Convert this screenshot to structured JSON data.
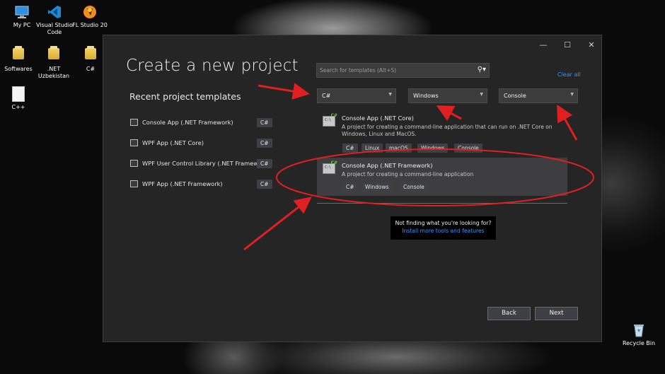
{
  "desktop": {
    "icons": [
      {
        "label": "My PC",
        "icon": "monitor-icon"
      },
      {
        "label": "Visual Studio Code",
        "icon": "vscode-icon"
      },
      {
        "label": "FL Studio 20",
        "icon": "fl-studio-icon"
      },
      {
        "label": "Softwares",
        "icon": "folder-icon"
      },
      {
        "label": ".NET Uzbekistan",
        "icon": "folder-icon"
      },
      {
        "label": "C#",
        "icon": "folder-icon"
      },
      {
        "label": "C++",
        "icon": "file-icon"
      },
      {
        "label": "Recycle Bin",
        "icon": "recycle-bin-icon"
      }
    ]
  },
  "window": {
    "minimize": "—",
    "maximize": "☐",
    "close": "✕"
  },
  "dialog": {
    "title": "Create a new project",
    "recent_heading": "Recent project templates",
    "recent_items": [
      {
        "label": "Console App (.NET Framework)",
        "lang": "C#"
      },
      {
        "label": "WPF App (.NET Core)",
        "lang": "C#"
      },
      {
        "label": "WPF User Control Library (.NET Framework)",
        "lang": "C#"
      },
      {
        "label": "WPF App (.NET Framework)",
        "lang": "C#"
      }
    ],
    "search_placeholder": "Search for templates (Alt+S)",
    "clear_all": "Clear all",
    "filters": {
      "language": "C#",
      "platform": "Windows",
      "project_type": "Console"
    },
    "templates": [
      {
        "name": "Console App (.NET Core)",
        "description": "A project for creating a command-line application that can run on .NET Core on Windows, Linux and MacOS.",
        "tags": [
          "C#",
          "Linux",
          "macOS",
          "Windows",
          "Console"
        ]
      },
      {
        "name": "Console App (.NET Framework)",
        "description": "A project for creating a command-line application",
        "tags": [
          "C#",
          "Windows",
          "Console"
        ]
      }
    ],
    "not_finding": "Not finding what you're looking for?",
    "install_more": "Install more tools and features",
    "back_label": "Back",
    "next_label": "Next"
  },
  "colors": {
    "dialog_bg": "#252526",
    "accent_link": "#3794ff",
    "annotation_red": "#e02020"
  }
}
